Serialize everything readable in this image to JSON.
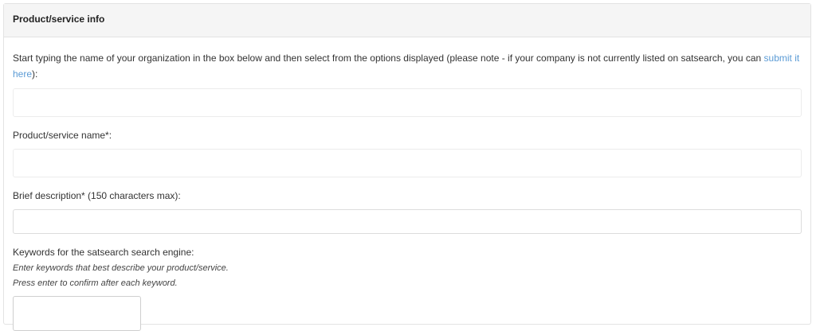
{
  "panel": {
    "title": "Product/service info"
  },
  "organization": {
    "intro_text": "Start typing the name of your organization in the box below and then select from the options displayed (please note - if your company is not currently listed on satsearch, you can ",
    "link_text": "submit it here",
    "intro_end": "):",
    "value": "",
    "placeholder": ""
  },
  "product_name": {
    "label": "Product/service name*:",
    "value": "",
    "placeholder": ""
  },
  "description": {
    "label": "Brief description* (150 characters max):",
    "value": "",
    "placeholder": ""
  },
  "keywords": {
    "label": "Keywords for the satsearch search engine:",
    "hint_line1": "Enter keywords that best describe your product/service.",
    "hint_line2": "Press enter to confirm after each keyword.",
    "value": "",
    "placeholder": ""
  }
}
